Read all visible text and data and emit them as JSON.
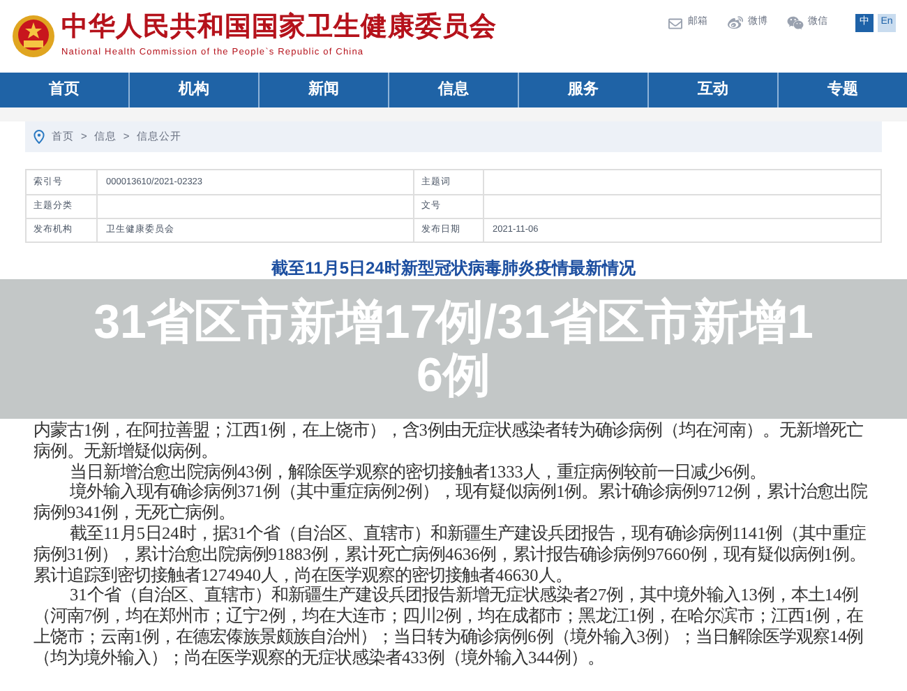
{
  "header": {
    "title": "中华人民共和国国家卫生健康委员会",
    "subtitle": "National Health Commission of the People`s Republic of China",
    "links": [
      {
        "kind": "mail",
        "label": "邮箱"
      },
      {
        "kind": "weibo",
        "label": "微博"
      },
      {
        "kind": "wechat",
        "label": "微信"
      }
    ],
    "languages": [
      {
        "label": "中",
        "selected": true
      },
      {
        "label": "En",
        "selected": false
      }
    ]
  },
  "nav": [
    "首页",
    "机构",
    "新闻",
    "信息",
    "服务",
    "互动",
    "专题"
  ],
  "breadcrumb": [
    "首页",
    "信息",
    "信息公开"
  ],
  "breadcrumb_separator": ">",
  "meta_table": [
    [
      {
        "label": "索引号",
        "value": "000013610/2021-02323"
      },
      {
        "label": "主题词"
      }
    ],
    [
      {
        "label": "主题分类"
      },
      {
        "label": "文号"
      }
    ],
    [
      {
        "label": "发布机构",
        "value": "卫生健康委员会"
      },
      {
        "label": "发布日期",
        "value": "2021-11-06"
      }
    ]
  ],
  "article_title": "截至11月5日24时新型冠状病毒肺炎疫情最新情况",
  "overlay_title": "31省区市新增17例/31省区市新增16例",
  "paragraphs": [
    {
      "text": "内蒙古1例，在阿拉善盟；江西1例，在上饶市），含3例由无症状感染者转为确诊病例（均在河南）。无新增死亡病例。无新增疑似病例。",
      "indent": false
    },
    {
      "text": "当日新增治愈出院病例43例，解除医学观察的密切接触者1333人，重症病例较前一日减少6例。",
      "indent": true
    },
    {
      "text": "境外输入现有确诊病例371例（其中重症病例2例），现有疑似病例1例。累计确诊病例9712例，累计治愈出院病例9341例，无死亡病例。",
      "indent": true
    },
    {
      "text": "截至11月5日24时，据31个省（自治区、直辖市）和新疆生产建设兵团报告，现有确诊病例1141例（其中重症病例31例），累计治愈出院病例91883例，累计死亡病例4636例，累计报告确诊病例97660例，现有疑似病例1例。累计追踪到密切接触者1274940人，尚在医学观察的密切接触者46630人。",
      "indent": true
    },
    {
      "text": "31个省（自治区、直辖市）和新疆生产建设兵团报告新增无症状感染者27例，其中境外输入13例，本土14例（河南7例，均在郑州市；辽宁2例，均在大连市；四川2例，均在成都市；黑龙江1例，在哈尔滨市；江西1例，在上饶市；云南1例，在德宏傣族景颇族自治州）；当日转为确诊病例6例（境外输入3例）；当日解除医学观察14例（均为境外输入）；尚在医学观察的无症状感染者433例（境外输入344例）。",
      "indent": true
    }
  ]
}
